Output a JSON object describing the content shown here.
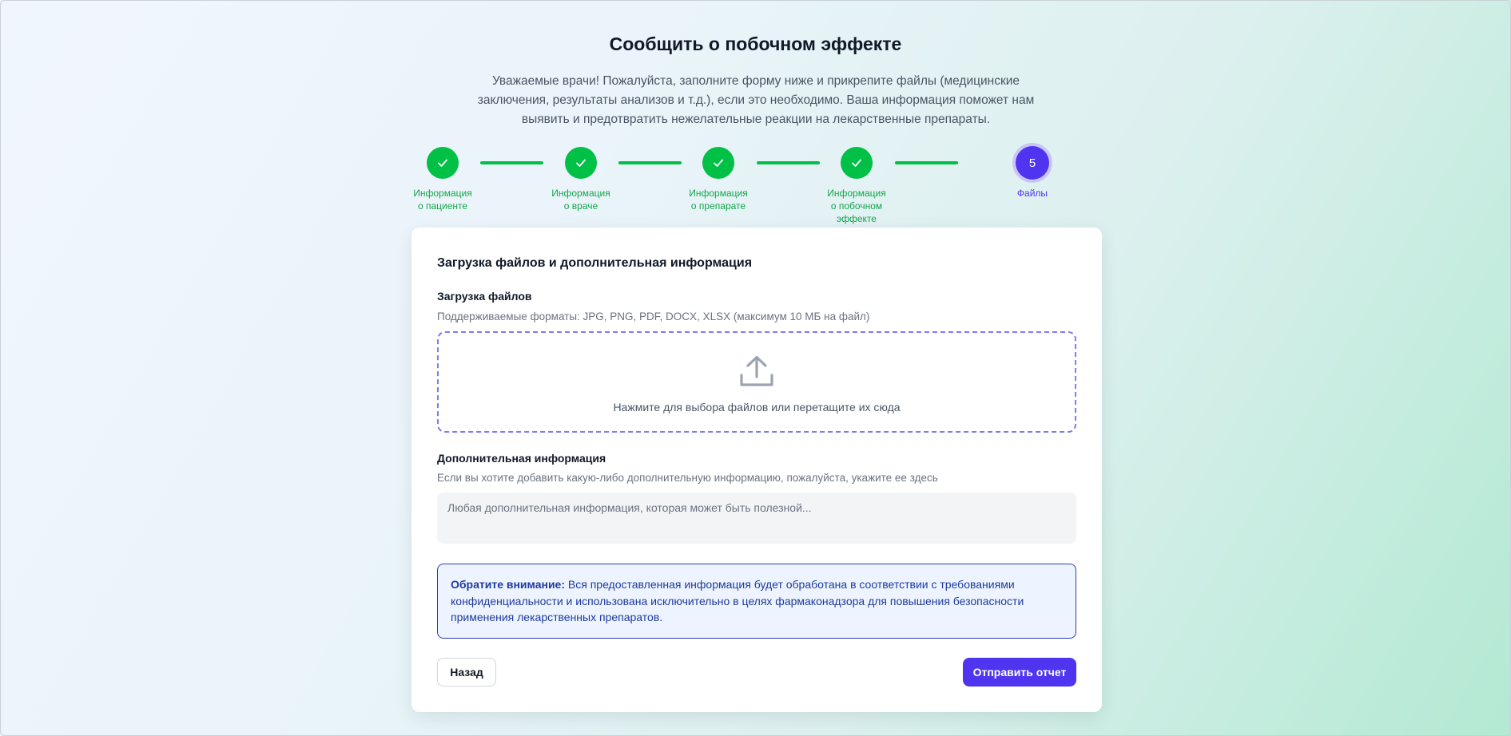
{
  "page": {
    "title": "Сообщить о побочном эффекте",
    "subtitle": "Уважаемые врачи! Пожалуйста, заполните форму ниже и прикрепите файлы (медицинские заключения, результаты анализов и т.д.), если это необходимо. Ваша информация поможет нам выявить и предотвратить нежелательные реакции на лекарственные препараты."
  },
  "colors": {
    "completed": "#00c046",
    "active": "#4f35f0",
    "notice_border": "#2e3bb0"
  },
  "stepper": {
    "steps": [
      {
        "label_line1": "Информация",
        "label_line2": "о пациенте",
        "label_line3": "",
        "status": "completed",
        "icon": "check-icon"
      },
      {
        "label_line1": "Информация",
        "label_line2": "о враче",
        "label_line3": "",
        "status": "completed",
        "icon": "check-icon"
      },
      {
        "label_line1": "Информация",
        "label_line2": "о препарате",
        "label_line3": "",
        "status": "completed",
        "icon": "check-icon"
      },
      {
        "label_line1": "Информация",
        "label_line2": "о побочном",
        "label_line3": "эффекте",
        "status": "completed",
        "icon": "check-icon"
      },
      {
        "number": "5",
        "label_line1": "Файлы",
        "label_line2": "",
        "label_line3": "",
        "status": "active"
      }
    ]
  },
  "form": {
    "section_title": "Загрузка файлов и дополнительная информация",
    "upload": {
      "label": "Загрузка файлов",
      "hint": "Поддерживаемые форматы: JPG, PNG, PDF, DOCX, XLSX (максимум 10 МБ на файл)",
      "dropzone_text": "Нажмите для выбора файлов или перетащите их сюда",
      "icon": "upload-icon"
    },
    "additional": {
      "label": "Дополнительная информация",
      "hint": "Если вы хотите добавить какую-либо дополнительную информацию, пожалуйста, укажите ее здесь",
      "placeholder": "Любая дополнительная информация, которая может быть полезной...",
      "value": ""
    },
    "notice": {
      "bold": "Обратите внимание:",
      "text": " Вся предоставленная информация будет обработана в соответствии с требованиями конфиденциальности и использована исключительно в целях фармаконадзора для повышения безопасности применения лекарственных препаратов."
    },
    "buttons": {
      "back": "Назад",
      "submit": "Отправить отчет"
    }
  }
}
